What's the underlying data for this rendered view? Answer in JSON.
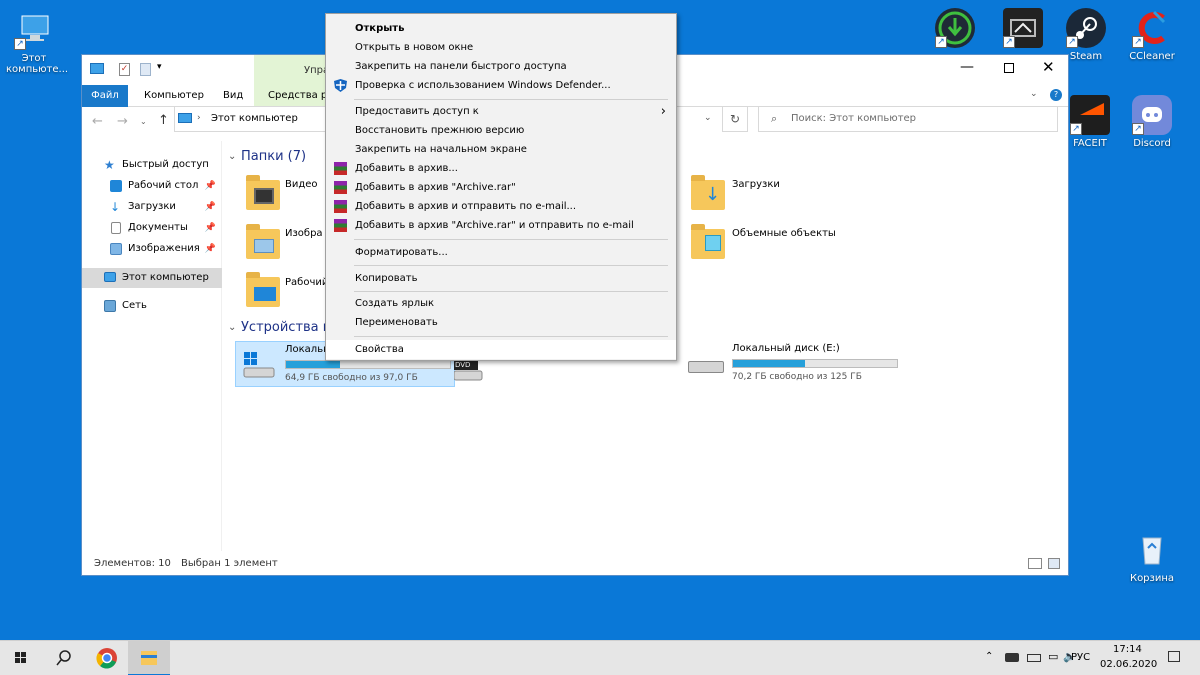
{
  "desktop": {
    "icons": [
      {
        "label": "Этот компьюте...",
        "name": "this-pc"
      },
      {
        "label": "",
        "name": "nvidia-app"
      },
      {
        "label": "",
        "name": "geforce-app"
      },
      {
        "label": "Steam",
        "name": "steam"
      },
      {
        "label": "CCleaner",
        "name": "ccleaner"
      },
      {
        "label": "FACEIT",
        "name": "faceit"
      },
      {
        "label": "Discord",
        "name": "discord"
      },
      {
        "label": "Корзина",
        "name": "recycle-bin"
      }
    ]
  },
  "explorer": {
    "ribbon_tabs": [
      "Файл",
      "Компьютер",
      "Вид",
      "Средства ра"
    ],
    "manage_tab": "Упра",
    "breadcrumb": "Этот компьютер",
    "search_placeholder": "Поиск: Этот компьютер",
    "nav": [
      {
        "label": "Быстрый доступ",
        "pin": false
      },
      {
        "label": "Рабочий стол",
        "pin": true
      },
      {
        "label": "Загрузки",
        "pin": true
      },
      {
        "label": "Документы",
        "pin": true
      },
      {
        "label": "Изображения",
        "pin": true
      },
      {
        "label": "Этот компьютер",
        "pin": false
      },
      {
        "label": "Сеть",
        "pin": false
      }
    ],
    "folders_group": "Папки (7)",
    "folders": [
      "Видео",
      "Изобра",
      "Рабочий",
      "Загрузки",
      "Объемные объекты"
    ],
    "devices_group": "Устройства и",
    "drives": [
      {
        "name": "Локальны",
        "info": "64,9 ГБ свободно из 97,0 ГБ",
        "used": 0.33
      },
      {
        "name": "DVD",
        "info": "",
        "used": 0
      },
      {
        "name": "Локальный диск (E:)",
        "info": "70,2 ГБ свободно из 125 ГБ",
        "used": 0.44
      }
    ],
    "status_items": "Элементов: 10",
    "status_selected": "Выбран 1 элемент"
  },
  "context_menu": {
    "items": [
      {
        "label": "Открыть",
        "bold": true
      },
      {
        "label": "Открыть в новом окне"
      },
      {
        "label": "Закрепить на панели быстрого доступа"
      },
      {
        "label": "Проверка с использованием Windows Defender..."
      },
      {
        "label": "Предоставить доступ к"
      },
      {
        "label": "Восстановить прежнюю версию"
      },
      {
        "label": "Закрепить на начальном экране"
      },
      {
        "label": "Добавить в архив..."
      },
      {
        "label": "Добавить в архив \"Archive.rar\""
      },
      {
        "label": "Добавить в архив и отправить по e-mail..."
      },
      {
        "label": "Добавить в архив \"Archive.rar\" и отправить по e-mail"
      },
      {
        "label": "Форматировать..."
      },
      {
        "label": "Копировать"
      },
      {
        "label": "Создать ярлык"
      },
      {
        "label": "Переименовать"
      },
      {
        "label": "Свойства"
      }
    ]
  },
  "taskbar": {
    "lang": "РУС",
    "time": "17:14",
    "date": "02.06.2020"
  },
  "colors": {
    "desktop": "#0a78d7",
    "accent": "#1979ca",
    "progress": "#26a0da"
  }
}
